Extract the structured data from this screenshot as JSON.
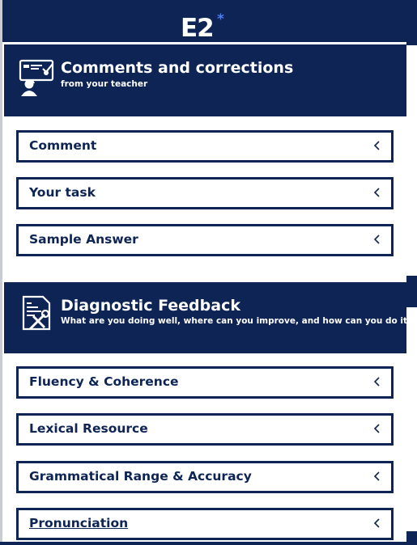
{
  "header": {
    "logo_text": "E2",
    "logo_mark": "*"
  },
  "sections": [
    {
      "title": "Comments and corrections",
      "subtitle": "from your teacher",
      "icon": "teacher-feedback-icon",
      "items": [
        {
          "label": "Comment"
        },
        {
          "label": "Your task"
        },
        {
          "label": "Sample Answer"
        }
      ]
    },
    {
      "title": "Diagnostic Feedback",
      "subtitle": "What are you doing well, where can you improve, and how can you do it?",
      "icon": "diagnostic-report-icon",
      "items": [
        {
          "label": "Fluency & Coherence"
        },
        {
          "label": "Lexical Resource"
        },
        {
          "label": "Grammatical Range & Accuracy"
        },
        {
          "label": "Pronunciation"
        }
      ]
    }
  ],
  "colors": {
    "navy": "#0d2455",
    "accent": "#4f7df0"
  }
}
